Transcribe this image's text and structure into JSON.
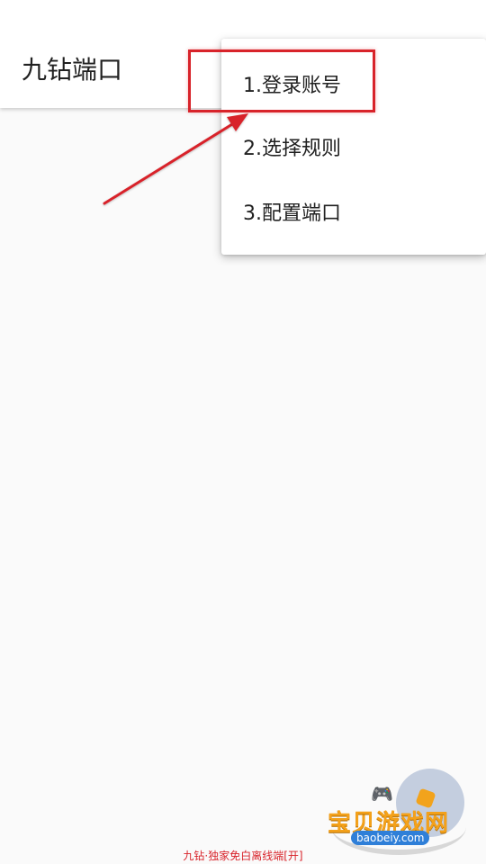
{
  "app_bar": {
    "title": "九钻端口"
  },
  "popup_menu": {
    "items": [
      {
        "label": "1.登录账号"
      },
      {
        "label": "2.选择规则"
      },
      {
        "label": "3.配置端口"
      }
    ]
  },
  "annotation": {
    "color": "#d8232a"
  },
  "watermark": {
    "title": "宝贝游戏网",
    "url": "baobeiy.com"
  },
  "footer": {
    "caption": "九钻·独家免白离线端[开]"
  },
  "colors": {
    "background": "#fafafa",
    "app_bar": "#ffffff",
    "menu": "#ffffff",
    "text": "#212121",
    "annotation": "#d8232a"
  }
}
